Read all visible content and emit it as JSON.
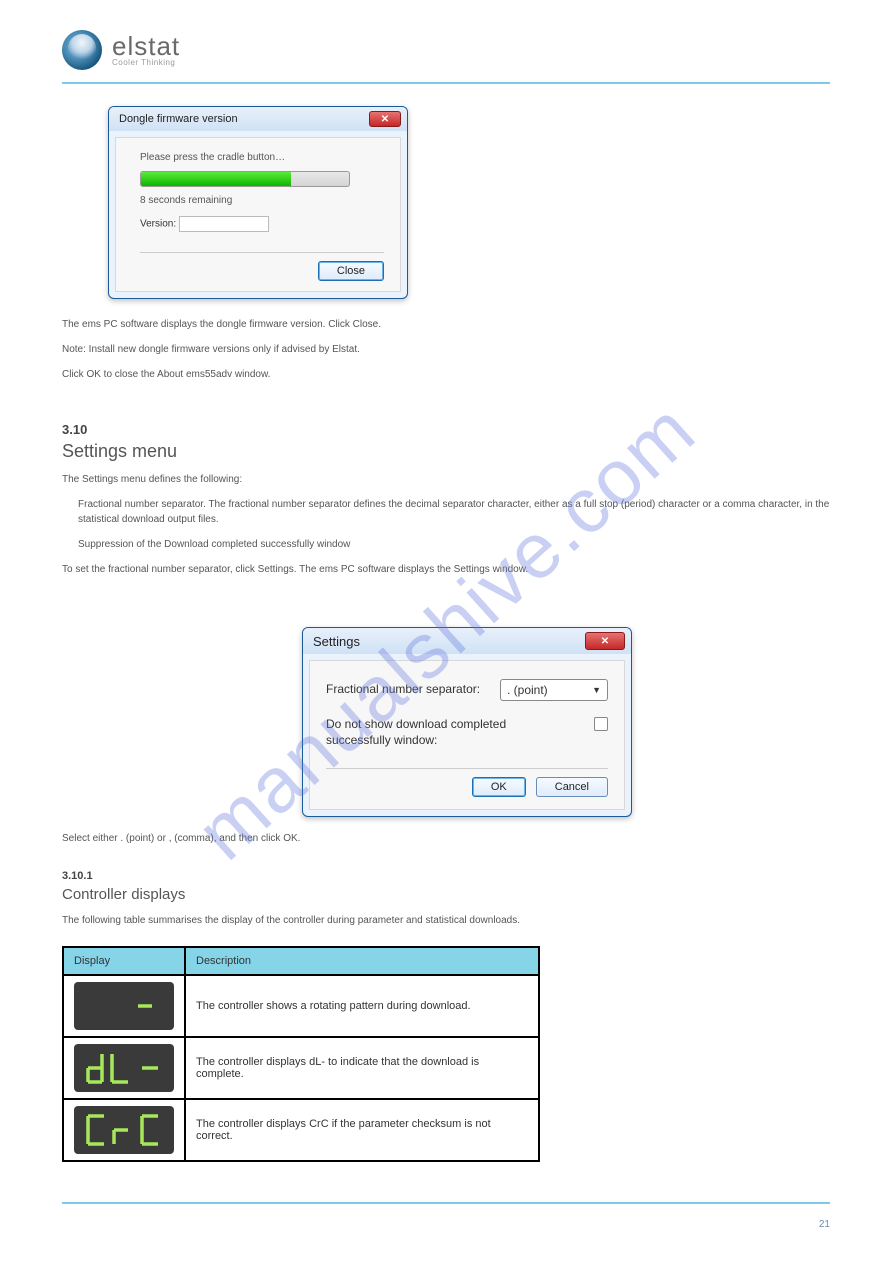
{
  "brand": {
    "name": "elstat",
    "tagline": "Cooler Thinking"
  },
  "watermark": "manualshive.com",
  "dialog1": {
    "title": "Dongle firmware version",
    "instruction": "Please press the cradle button…",
    "remaining": "8 seconds remaining",
    "version_label": "Version:",
    "close": "Close"
  },
  "text_between": {
    "p1": "The ems PC software displays the dongle firmware version. Click Close.",
    "p2": "Note: Install new dongle firmware versions only if advised by Elstat.",
    "p3": "Click OK to close the About ems55adv window."
  },
  "section": {
    "num": "3.10",
    "title": "Settings menu"
  },
  "settings_text": {
    "p1": "The Settings menu defines the following:",
    "b1": "Fractional number separator. The fractional number separator defines the decimal separator character, either as a full stop (period) character or a comma character, in the statistical download output files.",
    "b2": "Suppression of the Download completed successfully window",
    "p2": "To set the fractional number separator, click Settings. The ems PC software displays the Settings window."
  },
  "dialog2": {
    "title": "Settings",
    "label_sep": "Fractional number separator:",
    "sep_value": ". (point)",
    "label_suppress": "Do not show download completed successfully window:",
    "ok": "OK",
    "cancel": "Cancel"
  },
  "after_dialog2": "Select either . (point) or , (comma), and then click OK.",
  "subsection": {
    "num": "3.10.1",
    "title": "Controller displays"
  },
  "subsection_text": "The following table summarises the display of the controller during parameter and statistical downloads.",
  "table": {
    "h1": "Display",
    "h2": "Description",
    "rows": [
      {
        "disp": "dash",
        "desc": "The controller shows a rotating pattern during download."
      },
      {
        "disp": "dL-",
        "desc": "The controller displays dL- to indicate that the download is complete."
      },
      {
        "disp": "CrC",
        "desc": "The controller displays CrC if the parameter checksum is not correct."
      }
    ]
  },
  "page_number": "21"
}
